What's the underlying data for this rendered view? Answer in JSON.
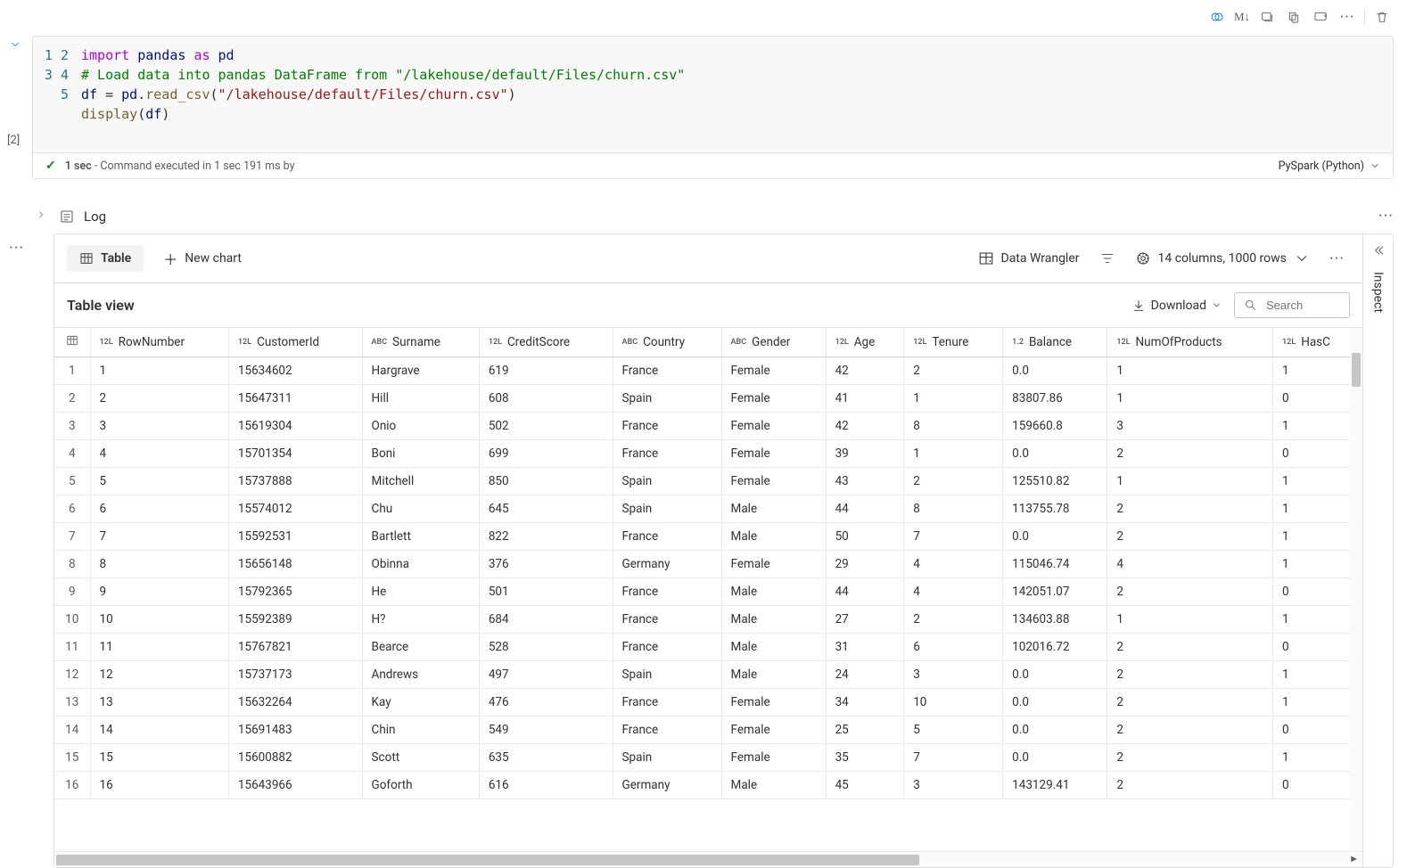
{
  "toolbar": {
    "markdown_label": "M↓"
  },
  "code": {
    "lines": [
      {
        "n": "1",
        "html": "<span class='tok-kw2'>import</span> <span class='tok-id'>pandas</span> <span class='tok-kw2'>as</span> <span class='tok-id'>pd</span>"
      },
      {
        "n": "2",
        "html": "<span class='tok-cm'># Load data into pandas DataFrame from \"/lakehouse/default/Files/churn.csv\"</span>"
      },
      {
        "n": "3",
        "html": "<span class='tok-id'>df</span> = <span class='tok-id'>pd</span>.<span class='tok-fn'>read_csv</span>(<span class='tok-str'>\"/lakehouse/default/Files/churn.csv\"</span>)"
      },
      {
        "n": "4",
        "html": "<span class='tok-fn'>display</span>(<span class='tok-id'>df</span>)"
      },
      {
        "n": "5",
        "html": ""
      }
    ]
  },
  "status": {
    "exec_count": "[2]",
    "time_label": "1 sec",
    "detail": "- Command executed in 1 sec 191 ms by",
    "kernel": "PySpark (Python)"
  },
  "log": {
    "label": "Log"
  },
  "output": {
    "table_btn": "Table",
    "newchart_btn": "New chart",
    "wrangler_btn": "Data Wrangler",
    "shape_label": "14 columns, 1000 rows",
    "view_title": "Table view",
    "download_label": "Download",
    "search_placeholder": "Search",
    "inspect_label": "Inspect"
  },
  "columns": [
    {
      "type": "idx",
      "label": ""
    },
    {
      "type": "12L",
      "label": "RowNumber"
    },
    {
      "type": "12L",
      "label": "CustomerId"
    },
    {
      "type": "ABC",
      "label": "Surname"
    },
    {
      "type": "12L",
      "label": "CreditScore"
    },
    {
      "type": "ABC",
      "label": "Country"
    },
    {
      "type": "ABC",
      "label": "Gender"
    },
    {
      "type": "12L",
      "label": "Age"
    },
    {
      "type": "12L",
      "label": "Tenure"
    },
    {
      "type": "1.2",
      "label": "Balance"
    },
    {
      "type": "12L",
      "label": "NumOfProducts"
    },
    {
      "type": "12L",
      "label": "HasC"
    }
  ],
  "rows": [
    [
      "1",
      "1",
      "15634602",
      "Hargrave",
      "619",
      "France",
      "Female",
      "42",
      "2",
      "0.0",
      "1",
      "1"
    ],
    [
      "2",
      "2",
      "15647311",
      "Hill",
      "608",
      "Spain",
      "Female",
      "41",
      "1",
      "83807.86",
      "1",
      "0"
    ],
    [
      "3",
      "3",
      "15619304",
      "Onio",
      "502",
      "France",
      "Female",
      "42",
      "8",
      "159660.8",
      "3",
      "1"
    ],
    [
      "4",
      "4",
      "15701354",
      "Boni",
      "699",
      "France",
      "Female",
      "39",
      "1",
      "0.0",
      "2",
      "0"
    ],
    [
      "5",
      "5",
      "15737888",
      "Mitchell",
      "850",
      "Spain",
      "Female",
      "43",
      "2",
      "125510.82",
      "1",
      "1"
    ],
    [
      "6",
      "6",
      "15574012",
      "Chu",
      "645",
      "Spain",
      "Male",
      "44",
      "8",
      "113755.78",
      "2",
      "1"
    ],
    [
      "7",
      "7",
      "15592531",
      "Bartlett",
      "822",
      "France",
      "Male",
      "50",
      "7",
      "0.0",
      "2",
      "1"
    ],
    [
      "8",
      "8",
      "15656148",
      "Obinna",
      "376",
      "Germany",
      "Female",
      "29",
      "4",
      "115046.74",
      "4",
      "1"
    ],
    [
      "9",
      "9",
      "15792365",
      "He",
      "501",
      "France",
      "Male",
      "44",
      "4",
      "142051.07",
      "2",
      "0"
    ],
    [
      "10",
      "10",
      "15592389",
      "H?",
      "684",
      "France",
      "Male",
      "27",
      "2",
      "134603.88",
      "1",
      "1"
    ],
    [
      "11",
      "11",
      "15767821",
      "Bearce",
      "528",
      "France",
      "Male",
      "31",
      "6",
      "102016.72",
      "2",
      "0"
    ],
    [
      "12",
      "12",
      "15737173",
      "Andrews",
      "497",
      "Spain",
      "Male",
      "24",
      "3",
      "0.0",
      "2",
      "1"
    ],
    [
      "13",
      "13",
      "15632264",
      "Kay",
      "476",
      "France",
      "Female",
      "34",
      "10",
      "0.0",
      "2",
      "1"
    ],
    [
      "14",
      "14",
      "15691483",
      "Chin",
      "549",
      "France",
      "Female",
      "25",
      "5",
      "0.0",
      "2",
      "0"
    ],
    [
      "15",
      "15",
      "15600882",
      "Scott",
      "635",
      "Spain",
      "Female",
      "35",
      "7",
      "0.0",
      "2",
      "1"
    ],
    [
      "16",
      "16",
      "15643966",
      "Goforth",
      "616",
      "Germany",
      "Male",
      "45",
      "3",
      "143129.41",
      "2",
      "0"
    ]
  ]
}
